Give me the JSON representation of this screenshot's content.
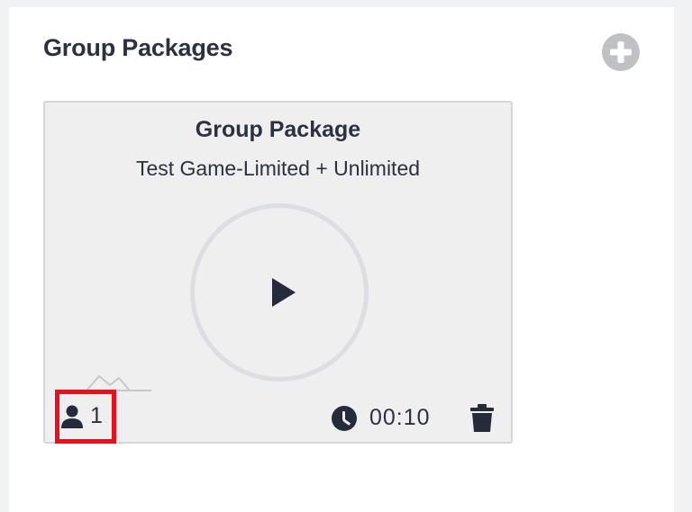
{
  "panel": {
    "title": "Group Packages",
    "add_icon": "plus-circle-icon"
  },
  "card": {
    "title": "Group Package",
    "subtitle": "Test Game-Limited + Unlimited",
    "play_icon": "play-icon",
    "players": {
      "icon": "user-icon",
      "count": "1"
    },
    "duration": {
      "icon": "clock-icon",
      "value": "00:10"
    },
    "delete_icon": "trash-icon"
  },
  "colors": {
    "highlight": "#e8101c",
    "text": "#2b3140",
    "card_bg": "#efefef"
  }
}
